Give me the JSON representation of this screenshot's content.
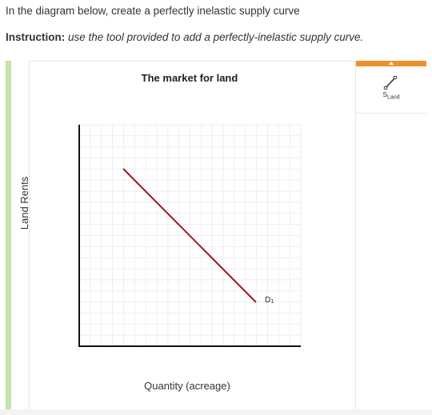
{
  "question": {
    "text": "In the diagram below, create a perfectly inelastic supply curve"
  },
  "instruction": {
    "label": "Instruction:",
    "body": "use the tool provided to add a perfectly-inelastic supply curve."
  },
  "graph": {
    "title": "The market for land",
    "y_axis_label": "Land Rents",
    "x_axis_label": "Quantity (acreage)",
    "demand_label_main": "D",
    "demand_label_sub": "1",
    "grid": true,
    "colors": {
      "demand_line": "#a01818",
      "axis": "#111111",
      "grid": "#eeeeee"
    }
  },
  "tools": {
    "supply_tool": {
      "label_main": "S",
      "label_sub": "Land",
      "icon": "line-segment-icon"
    },
    "accent_color": "#f0902a"
  }
}
